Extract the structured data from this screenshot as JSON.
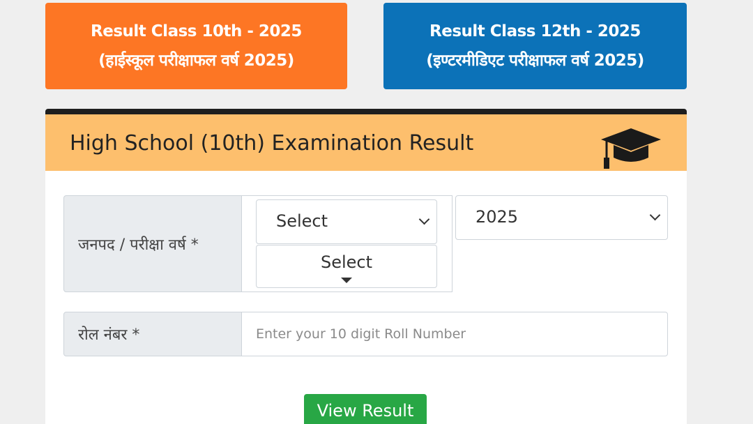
{
  "tabs": [
    {
      "line1": "Result Class 10th - 2025",
      "line2": "(हाईस्कूल परीक्षाफल वर्ष 2025)",
      "color": "#fd7624"
    },
    {
      "line1": "Result Class 12th - 2025",
      "line2": "(इण्टरमीडिएट परीक्षाफल वर्ष 2025)",
      "color": "#0c72b8"
    }
  ],
  "card": {
    "title": "High School (10th) Examination Result",
    "header_color": "#fdbf6d",
    "icon": "graduation-cap-icon"
  },
  "form": {
    "district_year_label": "जनपद / परीक्षा वर्ष *",
    "district_select_value": "Select",
    "sub_select_value": "Select",
    "year_select_value": "2025",
    "roll_label": "रोल नंबर *",
    "roll_placeholder": "Enter your 10 digit Roll Number",
    "submit_label": "View Result",
    "submit_color": "#28a745"
  }
}
